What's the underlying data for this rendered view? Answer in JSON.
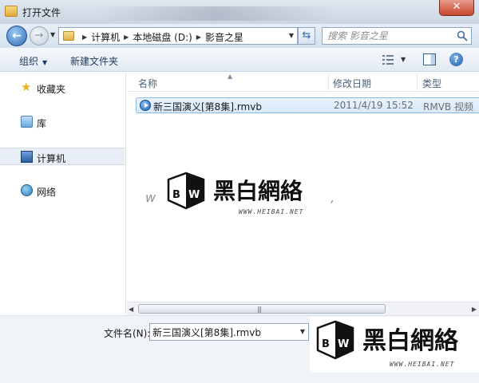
{
  "window": {
    "title": "打开文件",
    "close_label": "✕"
  },
  "address": {
    "crumbs": [
      "计算机",
      "本地磁盘 (D:)",
      "影音之星"
    ],
    "search_placeholder": "搜索 影音之星"
  },
  "toolbar": {
    "organize_label": "组织",
    "new_folder_label": "新建文件夹"
  },
  "navigation": [
    {
      "label": "收藏夹",
      "icon": "star-icon"
    },
    {
      "label": "库",
      "icon": "library-icon"
    },
    {
      "label": "计算机",
      "icon": "computer-icon",
      "selected": true
    },
    {
      "label": "网络",
      "icon": "network-icon"
    }
  ],
  "columns": {
    "name": "名称",
    "date": "修改日期",
    "type": "类型"
  },
  "files": [
    {
      "name": "新三国演义[第8集].rmvb",
      "modified": "2011/4/19 15:52",
      "type": "RMVB 视频"
    }
  ],
  "file_name_field": {
    "label": "文件名(N):",
    "value": "新三国演义[第8集].rmvb"
  },
  "watermark": {
    "text": "黑白網絡",
    "url": "WWW.HEIBAI.NET"
  },
  "colors": {
    "accent": "#2e6db8",
    "selection": "#d6e8fa"
  }
}
